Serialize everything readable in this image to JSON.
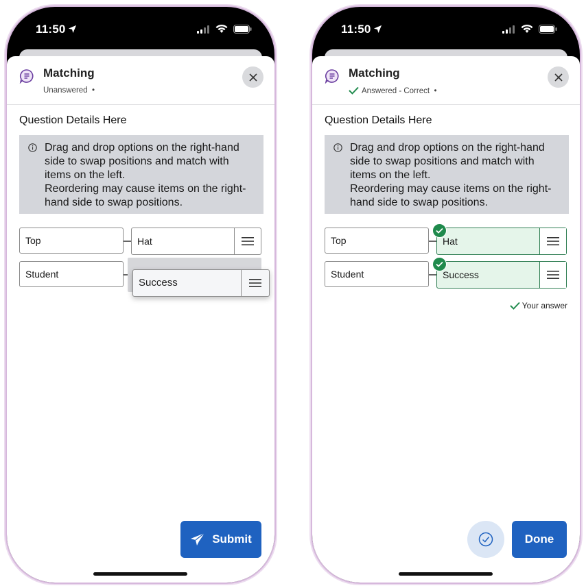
{
  "left": {
    "status": {
      "time": "11:50"
    },
    "header": {
      "title": "Matching",
      "status_text": "Unanswered",
      "dot": "•"
    },
    "question": {
      "details": "Question Details Here"
    },
    "info": {
      "lines": [
        "Drag and drop options on the right-hand side to swap positions and match with items on the left.",
        "Reordering may cause items on the right-hand side to swap positions."
      ]
    },
    "pairs": [
      {
        "left": "Top",
        "right": "Hat"
      },
      {
        "left": "Student",
        "right": ""
      }
    ],
    "dragging_item": "Success",
    "submit_label": "Submit"
  },
  "right": {
    "status": {
      "time": "11:50"
    },
    "header": {
      "title": "Matching",
      "status_text": "Answered - Correct",
      "dot": "•"
    },
    "question": {
      "details": "Question Details Here"
    },
    "info": {
      "lines": [
        "Drag and drop options on the right-hand side to swap positions and match with items on the left.",
        "Reordering may cause items on the right-hand side to swap positions."
      ]
    },
    "pairs": [
      {
        "left": "Top",
        "right": "Hat"
      },
      {
        "left": "Student",
        "right": "Success"
      }
    ],
    "your_answer": "Your answer",
    "done_label": "Done"
  },
  "colors": {
    "accent": "#1f62c0",
    "correct": "#1f8a4c",
    "correct_bg": "#e5f5ea",
    "info_bg": "#d4d6db",
    "icon_purple": "#6b3fa0"
  },
  "icons": [
    "location-arrow-icon",
    "cellular-signal-icon",
    "wifi-icon",
    "battery-icon",
    "question-bubble-icon",
    "close-icon",
    "info-icon",
    "drag-handle-icon",
    "checkmark-icon",
    "send-icon",
    "check-circle-icon"
  ]
}
